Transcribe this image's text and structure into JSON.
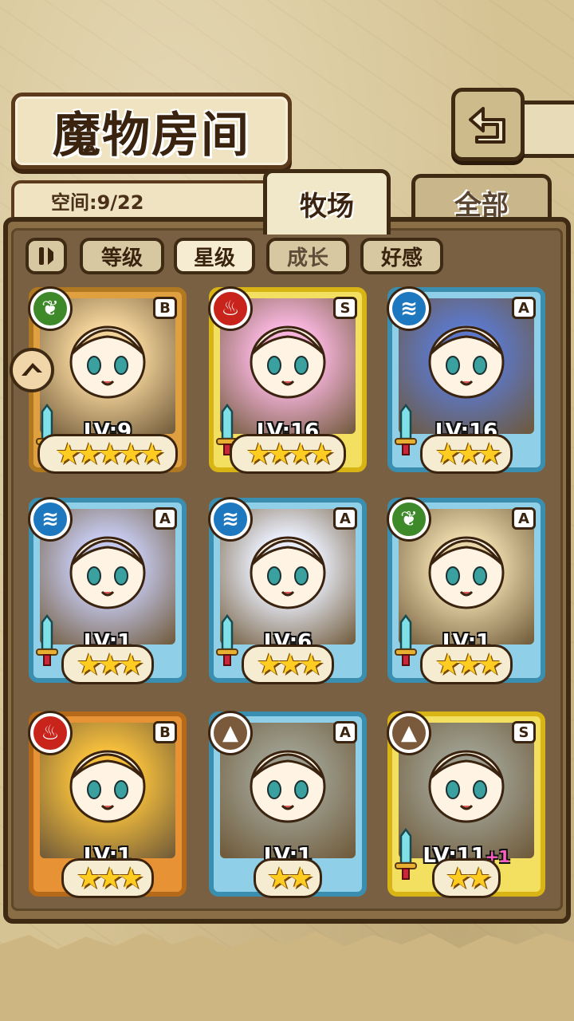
{
  "header": {
    "title": "魔物房间",
    "back_icon": "back-arrow-icon"
  },
  "space": {
    "label": "空间:9/22"
  },
  "tabs": [
    {
      "label": "牧场",
      "active": true
    },
    {
      "label": "全部",
      "active": false
    }
  ],
  "sort": {
    "toggle_icon": "pause-sort-icon",
    "buttons": [
      {
        "label": "等级",
        "active": false
      },
      {
        "label": "星级",
        "active": true
      },
      {
        "label": "成长",
        "active": false
      },
      {
        "label": "好感",
        "active": false
      }
    ]
  },
  "monsters": [
    {
      "element": "grass",
      "rank": "B",
      "level": "LV:9",
      "bonus": "",
      "stars": 5,
      "frame": "gold",
      "has_sword": true,
      "color": "#f3d39a"
    },
    {
      "element": "fire",
      "rank": "S",
      "level": "LV:16",
      "bonus": "",
      "stars": 4,
      "frame": "yellow",
      "has_sword": true,
      "color": "#f6b4dc"
    },
    {
      "element": "water",
      "rank": "A",
      "level": "LV:16",
      "bonus": "",
      "stars": 3,
      "frame": "blue",
      "has_sword": true,
      "color": "#5d78c8"
    },
    {
      "element": "water",
      "rank": "A",
      "level": "LV:1",
      "bonus": "",
      "stars": 3,
      "frame": "blue",
      "has_sword": true,
      "color": "#c4c8ec"
    },
    {
      "element": "water",
      "rank": "A",
      "level": "LV:6",
      "bonus": "",
      "stars": 3,
      "frame": "blue",
      "has_sword": true,
      "color": "#e8ecf8"
    },
    {
      "element": "grass",
      "rank": "A",
      "level": "LV:1",
      "bonus": "",
      "stars": 3,
      "frame": "blue",
      "has_sword": true,
      "color": "#e8d6a8"
    },
    {
      "element": "fire",
      "rank": "B",
      "level": "LV:1",
      "bonus": "",
      "stars": 3,
      "frame": "orange",
      "has_sword": false,
      "color": "#f4be3c"
    },
    {
      "element": "earth",
      "rank": "A",
      "level": "LV:1",
      "bonus": "",
      "stars": 2,
      "frame": "blue",
      "has_sword": false,
      "color": "#9c9c8c"
    },
    {
      "element": "earth",
      "rank": "S",
      "level": "LV:11",
      "bonus": "+1",
      "stars": 2,
      "frame": "yellow",
      "has_sword": true,
      "color": "#9c9c8c"
    }
  ],
  "colors": {
    "grass": "#3e8a2a",
    "fire": "#c8241c",
    "water": "#1e78c0",
    "earth": "#7a5a3a"
  }
}
